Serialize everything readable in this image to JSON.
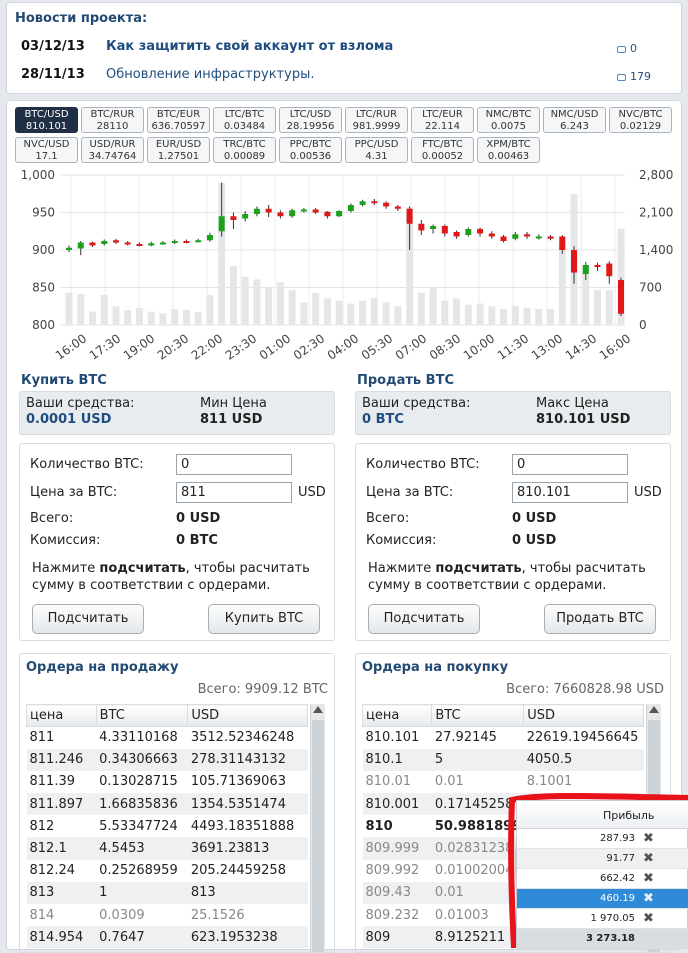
{
  "news": {
    "title": "Новости проекта:",
    "items": [
      {
        "date": "03/12/13",
        "text": "Как защитить свой аккаунт от взлома",
        "count": "0",
        "bold": true
      },
      {
        "date": "28/11/13",
        "text": "Обновление инфраструктуры.",
        "count": "179",
        "bold": false
      }
    ]
  },
  "pairs": [
    {
      "name": "BTC/USD",
      "value": "810.101",
      "active": true
    },
    {
      "name": "BTC/RUR",
      "value": "28110"
    },
    {
      "name": "BTC/EUR",
      "value": "636.70597"
    },
    {
      "name": "LTC/BTC",
      "value": "0.03484"
    },
    {
      "name": "LTC/USD",
      "value": "28.19956"
    },
    {
      "name": "LTC/RUR",
      "value": "981.9999"
    },
    {
      "name": "LTC/EUR",
      "value": "22.114"
    },
    {
      "name": "NMC/BTC",
      "value": "0.0075"
    },
    {
      "name": "NMC/USD",
      "value": "6.243"
    },
    {
      "name": "NVC/BTC",
      "value": "0.02129"
    },
    {
      "name": "NVC/USD",
      "value": "17.1"
    },
    {
      "name": "USD/RUR",
      "value": "34.74764"
    },
    {
      "name": "EUR/USD",
      "value": "1.27501"
    },
    {
      "name": "TRC/BTC",
      "value": "0.00089"
    },
    {
      "name": "PPC/BTC",
      "value": "0.00536"
    },
    {
      "name": "PPC/USD",
      "value": "4.31"
    },
    {
      "name": "FTC/BTC",
      "value": "0.00052"
    },
    {
      "name": "XPM/BTC",
      "value": "0.00463"
    }
  ],
  "chart_data": {
    "type": "candlestick",
    "x_ticks": [
      "16:00",
      "17:30",
      "19:00",
      "20:30",
      "22:00",
      "23:30",
      "01:00",
      "02:30",
      "04:00",
      "05:30",
      "07:00",
      "08:30",
      "10:00",
      "11:30",
      "13:00",
      "14:30",
      "16:00"
    ],
    "y_left_ticks": [
      "800",
      "850",
      "900",
      "950",
      "1,000"
    ],
    "y_left_range": [
      800,
      1000
    ],
    "y_right_ticks": [
      "0",
      "700",
      "1,400",
      "2,100",
      "2,800"
    ],
    "y_right_range": [
      0,
      2800
    ],
    "grid": true,
    "candles": [
      {
        "o": 900,
        "c": 903,
        "h": 906,
        "l": 897,
        "v": 600
      },
      {
        "o": 902,
        "c": 910,
        "h": 912,
        "l": 893,
        "v": 580
      },
      {
        "o": 910,
        "c": 906,
        "h": 911,
        "l": 904,
        "v": 250
      },
      {
        "o": 908,
        "c": 912,
        "h": 914,
        "l": 906,
        "v": 560
      },
      {
        "o": 913,
        "c": 910,
        "h": 915,
        "l": 908,
        "v": 350
      },
      {
        "o": 910,
        "c": 908,
        "h": 912,
        "l": 906,
        "v": 280
      },
      {
        "o": 908,
        "c": 907,
        "h": 910,
        "l": 905,
        "v": 320
      },
      {
        "o": 906,
        "c": 909,
        "h": 911,
        "l": 905,
        "v": 250
      },
      {
        "o": 908,
        "c": 910,
        "h": 912,
        "l": 907,
        "v": 220
      },
      {
        "o": 910,
        "c": 912,
        "h": 914,
        "l": 908,
        "v": 300
      },
      {
        "o": 912,
        "c": 911,
        "h": 914,
        "l": 909,
        "v": 280
      },
      {
        "o": 911,
        "c": 913,
        "h": 915,
        "l": 910,
        "v": 240
      },
      {
        "o": 913,
        "c": 920,
        "h": 923,
        "l": 911,
        "v": 560
      },
      {
        "o": 925,
        "c": 945,
        "h": 990,
        "l": 918,
        "v": 2650
      },
      {
        "o": 945,
        "c": 940,
        "h": 950,
        "l": 928,
        "v": 1100
      },
      {
        "o": 942,
        "c": 948,
        "h": 952,
        "l": 938,
        "v": 900
      },
      {
        "o": 948,
        "c": 955,
        "h": 958,
        "l": 945,
        "v": 850
      },
      {
        "o": 955,
        "c": 950,
        "h": 960,
        "l": 944,
        "v": 700
      },
      {
        "o": 950,
        "c": 945,
        "h": 953,
        "l": 942,
        "v": 800
      },
      {
        "o": 945,
        "c": 953,
        "h": 955,
        "l": 943,
        "v": 650
      },
      {
        "o": 953,
        "c": 954,
        "h": 956,
        "l": 950,
        "v": 420
      },
      {
        "o": 954,
        "c": 950,
        "h": 956,
        "l": 948,
        "v": 600
      },
      {
        "o": 951,
        "c": 945,
        "h": 952,
        "l": 942,
        "v": 500
      },
      {
        "o": 945,
        "c": 952,
        "h": 953,
        "l": 944,
        "v": 450
      },
      {
        "o": 952,
        "c": 960,
        "h": 962,
        "l": 950,
        "v": 400
      },
      {
        "o": 960,
        "c": 965,
        "h": 967,
        "l": 958,
        "v": 450
      },
      {
        "o": 965,
        "c": 963,
        "h": 968,
        "l": 960,
        "v": 500
      },
      {
        "o": 963,
        "c": 958,
        "h": 965,
        "l": 955,
        "v": 420
      },
      {
        "o": 958,
        "c": 955,
        "h": 960,
        "l": 952,
        "v": 350
      },
      {
        "o": 955,
        "c": 935,
        "h": 958,
        "l": 900,
        "v": 2200
      },
      {
        "o": 935,
        "c": 926,
        "h": 940,
        "l": 920,
        "v": 600
      },
      {
        "o": 928,
        "c": 932,
        "h": 934,
        "l": 922,
        "v": 700
      },
      {
        "o": 932,
        "c": 922,
        "h": 934,
        "l": 918,
        "v": 450
      },
      {
        "o": 924,
        "c": 918,
        "h": 926,
        "l": 915,
        "v": 500
      },
      {
        "o": 920,
        "c": 928,
        "h": 930,
        "l": 918,
        "v": 380
      },
      {
        "o": 928,
        "c": 922,
        "h": 930,
        "l": 918,
        "v": 400
      },
      {
        "o": 922,
        "c": 918,
        "h": 925,
        "l": 915,
        "v": 350
      },
      {
        "o": 918,
        "c": 912,
        "h": 920,
        "l": 910,
        "v": 300
      },
      {
        "o": 915,
        "c": 921,
        "h": 924,
        "l": 913,
        "v": 350
      },
      {
        "o": 921,
        "c": 918,
        "h": 924,
        "l": 915,
        "v": 320
      },
      {
        "o": 916,
        "c": 918,
        "h": 921,
        "l": 914,
        "v": 300
      },
      {
        "o": 918,
        "c": 915,
        "h": 920,
        "l": 913,
        "v": 300
      },
      {
        "o": 918,
        "c": 900,
        "h": 920,
        "l": 895,
        "v": 1500
      },
      {
        "o": 900,
        "c": 870,
        "h": 905,
        "l": 855,
        "v": 2450
      },
      {
        "o": 868,
        "c": 880,
        "h": 884,
        "l": 860,
        "v": 1100
      },
      {
        "o": 880,
        "c": 878,
        "h": 883,
        "l": 872,
        "v": 650
      },
      {
        "o": 882,
        "c": 865,
        "h": 885,
        "l": 855,
        "v": 650
      },
      {
        "o": 860,
        "c": 815,
        "h": 863,
        "l": 812,
        "v": 1800
      }
    ]
  },
  "buy": {
    "title": "Купить BTC",
    "funds_label": "Ваши средства:",
    "funds_value": "0.0001 USD",
    "price_label": "Мин Цена",
    "price_value": "811 USD",
    "qty_label": "Количество BTC:",
    "qty_value": "0",
    "unit_price_label": "Цена за BTC:",
    "unit_price_value": "811",
    "unit_price_cur": "USD",
    "total_label": "Всего:",
    "total_value": "0 USD",
    "fee_label": "Комиссия:",
    "fee_value": "0 BTC",
    "note_pre": "Нажмите ",
    "note_bold": "подсчитать",
    "note_post": ", чтобы расчитать сумму в соответствии с ордерами.",
    "calc_button": "Подсчитать",
    "action_button": "Купить BTC"
  },
  "sell": {
    "title": "Продать BTC",
    "funds_label": "Ваши средства:",
    "funds_value": "0 BTC",
    "price_label": "Макс Цена",
    "price_value": "810.101 USD",
    "qty_label": "Количество BTC:",
    "qty_value": "0",
    "unit_price_label": "Цена за BTC:",
    "unit_price_value": "810.101",
    "unit_price_cur": "USD",
    "total_label": "Всего:",
    "total_value": "0 USD",
    "fee_label": "Комиссия:",
    "fee_value": "0 USD",
    "note_pre": "Нажмите ",
    "note_bold": "подсчитать",
    "note_post": ", чтобы расчитать сумму в соответствии с ордерами.",
    "calc_button": "Подсчитать",
    "action_button": "Продать BTC"
  },
  "sell_orders": {
    "title": "Ордера на продажу",
    "total": "Всего: 9909.12 BTC",
    "headers": [
      "цена",
      "BTC",
      "USD"
    ],
    "rows": [
      [
        "811",
        "4.33110168",
        "3512.52346248"
      ],
      [
        "811.246",
        "0.34306663",
        "278.31143132"
      ],
      [
        "811.39",
        "0.13028715",
        "105.71369063"
      ],
      [
        "811.897",
        "1.66835836",
        "1354.5351474"
      ],
      [
        "812",
        "5.53347724",
        "4493.18351888"
      ],
      [
        "812.1",
        "4.5453",
        "3691.23813"
      ],
      [
        "812.24",
        "0.25268959",
        "205.24459258"
      ],
      [
        "813",
        "1",
        "813"
      ],
      [
        "814",
        "0.0309",
        "25.1526"
      ],
      [
        "814.954",
        "0.7647",
        "623.1953238"
      ]
    ]
  },
  "buy_orders": {
    "title": "Ордера на покупку",
    "total": "Всего: 7660828.98 USD",
    "headers": [
      "цена",
      "BTC",
      "USD"
    ],
    "rows": [
      [
        "810.101",
        "27.92145",
        "22619.19456645"
      ],
      [
        "810.1",
        "5",
        "4050.5"
      ],
      [
        "810.01",
        "0.01",
        "8.1001"
      ],
      [
        "810.001",
        "0.17145258",
        ""
      ],
      [
        "810",
        "50.9881899",
        ""
      ],
      [
        "809.999",
        "0.02831238",
        ""
      ],
      [
        "809.992",
        "0.01002004",
        ""
      ],
      [
        "809.43",
        "0.01",
        ""
      ],
      [
        "809.232",
        "0.01003",
        ""
      ],
      [
        "809",
        "8.9125211",
        ""
      ]
    ]
  },
  "profit": {
    "header": "Прибыль",
    "rows": [
      "287.93",
      "91.77",
      "662.42",
      "460.19",
      "1 970.05"
    ],
    "total": "3 273.18"
  }
}
